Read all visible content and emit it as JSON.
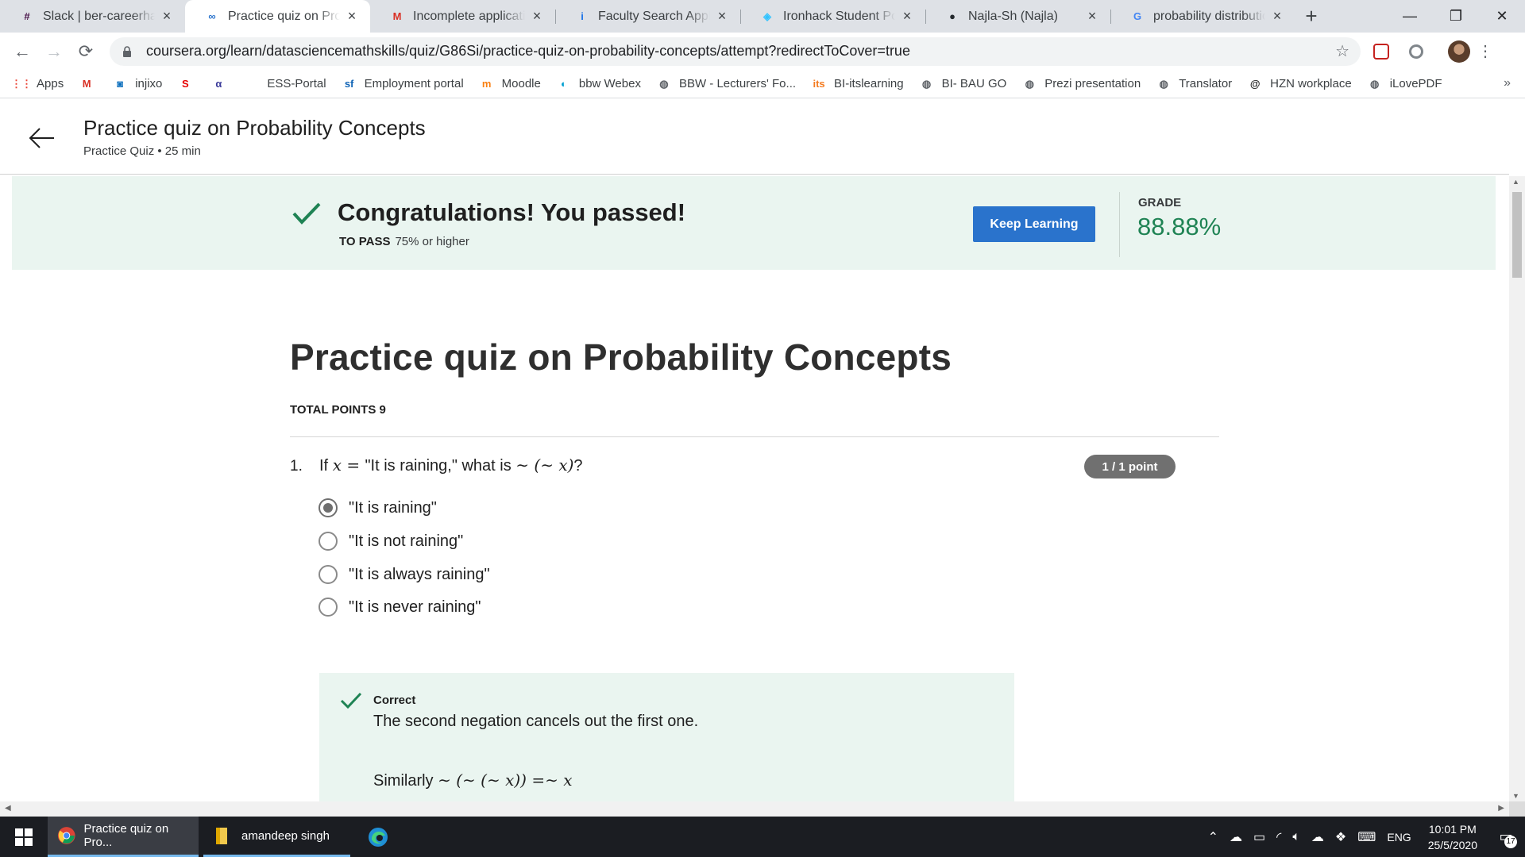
{
  "browser": {
    "tabs": [
      {
        "title": "Slack | ber-careerhack-",
        "icon": "slack-icon",
        "color": "#4a154b",
        "glyph": "#"
      },
      {
        "title": "Practice quiz on Probal",
        "icon": "coursera-icon",
        "color": "#2a73cc",
        "glyph": "∞",
        "active": true
      },
      {
        "title": "Incomplete application",
        "icon": "gmail-icon",
        "color": "#d93025",
        "glyph": "M"
      },
      {
        "title": "Faculty Search Applicat",
        "icon": "info-icon",
        "color": "#1a73e8",
        "glyph": "i"
      },
      {
        "title": "Ironhack Student Porta",
        "icon": "ironhack-icon",
        "color": "#32c3ff",
        "glyph": "◈"
      },
      {
        "title": "Najla-Sh (Najla)",
        "icon": "github-icon",
        "color": "#24292e",
        "glyph": "●"
      },
      {
        "title": "probability distribution",
        "icon": "google-icon",
        "color": "#4285f4",
        "glyph": "G"
      }
    ],
    "new_tab_glyph": "+",
    "close_glyph": "×",
    "url": "coursera.org/learn/datasciencemathskills/quiz/G86Si/practice-quiz-on-probability-concepts/attempt?redirectToCover=true",
    "bookmarks": [
      {
        "label": "Apps",
        "icon": "apps-grid-icon",
        "color": "#ea4335",
        "glyph": "⋮⋮"
      },
      {
        "label": "",
        "icon": "gmail-icon",
        "color": "#d93025",
        "glyph": "M"
      },
      {
        "label": "injixo",
        "icon": "injixo-icon",
        "color": "#0a6ebd",
        "glyph": "◙"
      },
      {
        "label": "",
        "icon": "sparkasse-icon",
        "color": "#e60000",
        "glyph": "S"
      },
      {
        "label": "",
        "icon": "alpha-icon",
        "color": "#3b3b9a",
        "glyph": "α"
      },
      {
        "label": "ESS-Portal",
        "icon": "apple-icon",
        "color": "#555555",
        "glyph": ""
      },
      {
        "label": "Employment portal",
        "icon": "sf-icon",
        "color": "#1064b6",
        "glyph": "sf"
      },
      {
        "label": "Moodle",
        "icon": "moodle-icon",
        "color": "#f98012",
        "glyph": "m"
      },
      {
        "label": "bbw Webex",
        "icon": "webex-icon",
        "color": "#00a0d1",
        "glyph": "◐"
      },
      {
        "label": "BBW - Lecturers' Fo...",
        "icon": "globe-icon",
        "color": "#5f6368",
        "glyph": "◍"
      },
      {
        "label": "BI-itslearning",
        "icon": "itslearning-icon",
        "color": "#f47b20",
        "glyph": "its"
      },
      {
        "label": "BI- BAU GO",
        "icon": "globe-icon",
        "color": "#5f6368",
        "glyph": "◍"
      },
      {
        "label": "Prezi presentation",
        "icon": "globe-icon",
        "color": "#5f6368",
        "glyph": "◍"
      },
      {
        "label": "Translator",
        "icon": "globe-icon",
        "color": "#5f6368",
        "glyph": "◍"
      },
      {
        "label": "HZN workplace",
        "icon": "hzn-icon",
        "color": "#1f1f1f",
        "glyph": "@"
      },
      {
        "label": "iLovePDF",
        "icon": "globe-icon",
        "color": "#5f6368",
        "glyph": "◍"
      }
    ],
    "more_glyph": "»"
  },
  "header": {
    "title": "Practice quiz on Probability Concepts",
    "subtitle": "Practice Quiz • 25 min"
  },
  "banner": {
    "message": "Congratulations! You passed!",
    "to_pass_label": "TO PASS",
    "to_pass_value": "75% or higher",
    "button_label": "Keep Learning",
    "grade_label": "GRADE",
    "grade_value": "88.88%",
    "accent_color": "#1f8354",
    "button_color": "#2a73cc"
  },
  "quiz": {
    "title": "Practice quiz on Probability Concepts",
    "total_points": "TOTAL POINTS 9",
    "question": {
      "number": "1.",
      "prefix": "If",
      "var": "x",
      "eq": " = ",
      "middle": "\"It is raining,\" what is ",
      "expr": "∼ (∼ x)",
      "suffix": "?",
      "points": "1 / 1 point",
      "options": [
        {
          "label": "\"It is raining\"",
          "selected": true
        },
        {
          "label": "\"It is not raining\"",
          "selected": false
        },
        {
          "label": "\"It is always raining\"",
          "selected": false
        },
        {
          "label": "\"It is never raining\"",
          "selected": false
        }
      ],
      "feedback": {
        "title": "Correct",
        "text": "The second negation cancels out the first one.",
        "similarly": "Similarly ",
        "math": "∼ (∼ (∼ x)) =∼ x"
      }
    }
  },
  "taskbar": {
    "items": [
      {
        "label": "Practice quiz on Pro...",
        "icon": "chrome-icon",
        "active": true
      },
      {
        "label": "amandeep singh",
        "icon": "folder-icon",
        "active": false
      },
      {
        "label": "",
        "icon": "edge-icon",
        "active": false
      }
    ],
    "language": "ENG",
    "time": "10:01 PM",
    "date": "25/5/2020",
    "notification_count": "17"
  }
}
